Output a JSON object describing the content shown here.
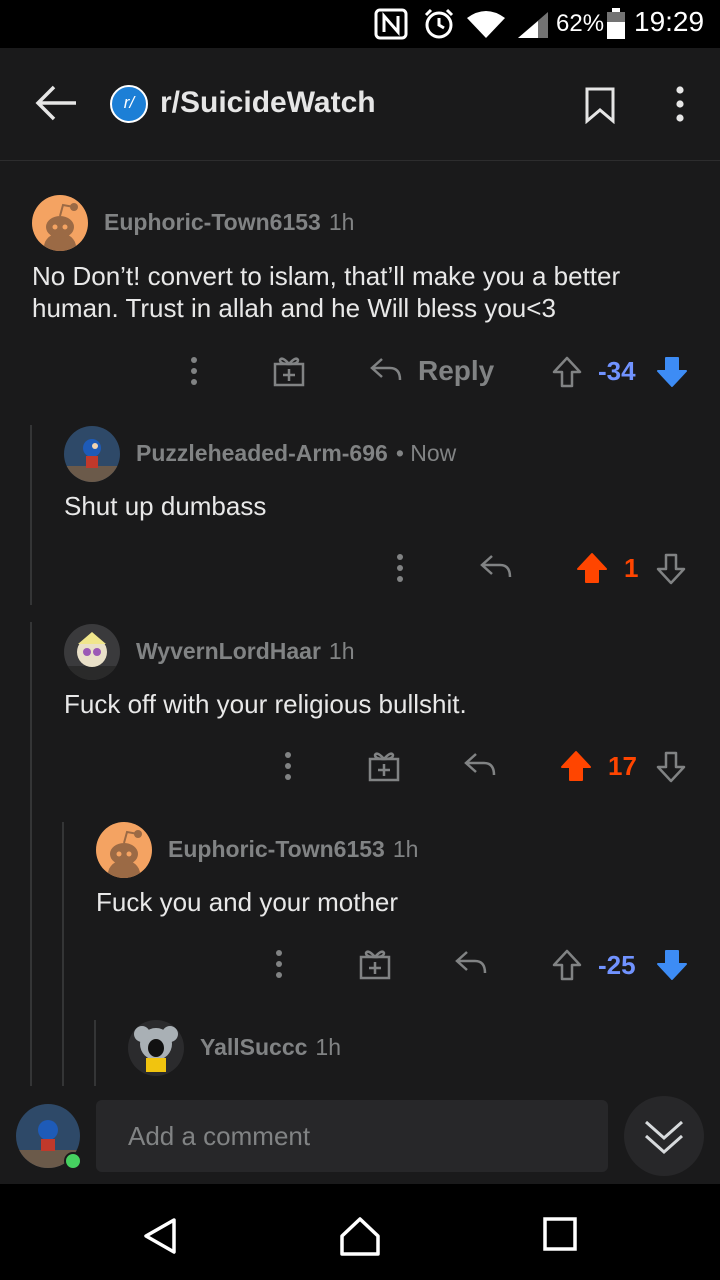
{
  "status_bar": {
    "battery": "62%",
    "time": "19:29",
    "icons": [
      "nfc-icon",
      "alarm-icon",
      "wifi-icon",
      "signal-icon",
      "battery-icon"
    ]
  },
  "header": {
    "subreddit": "r/SuicideWatch",
    "subreddit_icon_text": "r/"
  },
  "comments": [
    {
      "username": "Euphoric-Town6153",
      "time": "1h",
      "body_line1": "No Don’t! convert to islam, that’ll make you a better",
      "body_line2": "human. Trust in allah and he Will bless you<3",
      "reply_label": "Reply",
      "score": "-34",
      "vote_state": "downvoted"
    },
    {
      "username": "Puzzleheaded-Arm-696",
      "time": "• Now",
      "body": "Shut up dumbass",
      "score": "1",
      "vote_state": "upvoted"
    },
    {
      "username": "WyvernLordHaar",
      "time": "1h",
      "body": "Fuck off with your religious bullshit.",
      "score": "17",
      "vote_state": "upvoted"
    },
    {
      "username": "Euphoric-Town6153",
      "time": "1h",
      "body": "Fuck you and your mother",
      "score": "-25",
      "vote_state": "downvoted"
    },
    {
      "username": "YallSuccc",
      "time": "1h"
    }
  ],
  "composer": {
    "placeholder": "Add a comment"
  },
  "colors": {
    "upvote": "#ff4500",
    "downvote": "#7193ff",
    "background": "#1a1a1b"
  }
}
